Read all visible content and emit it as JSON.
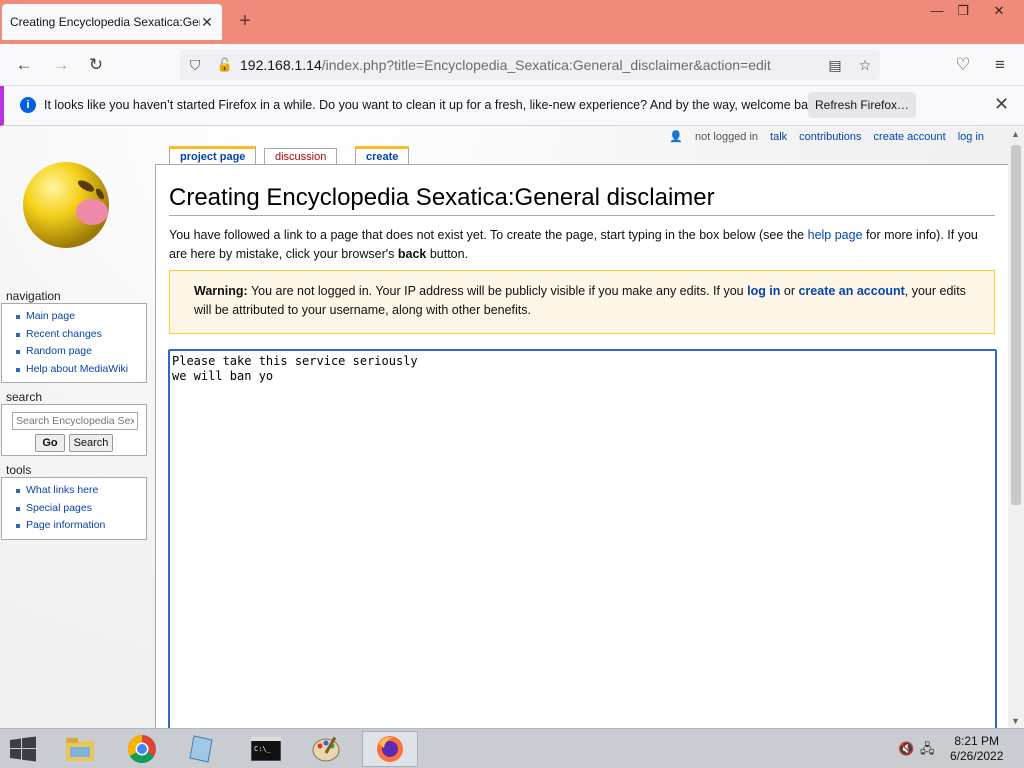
{
  "browser": {
    "tab_title": "Creating Encyclopedia Sexatica:General disclaimer",
    "url_host": "192.168.1.14",
    "url_path": "/index.php?title=Encyclopedia_Sexatica:General_disclaimer&action=edit",
    "notification": "It looks like you haven’t started Firefox in a while. Do you want to clean it up for a fresh, like-new experience? And by the way, welcome back!",
    "refresh_button": "Refresh Firefox…"
  },
  "personal_tools": [
    "not logged in",
    "talk",
    "contributions",
    "create account",
    "log in"
  ],
  "content_tabs": {
    "project_page": "project page",
    "discussion": "discussion",
    "create": "create"
  },
  "sidebar": {
    "navigation_title": "navigation",
    "navigation": [
      "Main page",
      "Recent changes",
      "Random page",
      "Help about MediaWiki"
    ],
    "search_title": "search",
    "search_placeholder": "Search Encyclopedia Sexatica",
    "go_button": "Go",
    "search_button": "Search",
    "tools_title": "tools",
    "tools": [
      "What links here",
      "Special pages",
      "Page information"
    ]
  },
  "article": {
    "heading": "Creating Encyclopedia Sexatica:General disclaimer",
    "intro_part1": "You have followed a link to a page that does not exist yet. To create the page, start typing in the box below (see the ",
    "intro_link": "help page",
    "intro_part2": " for more info). If you are here by mistake, click your browser's ",
    "intro_bold": "back",
    "intro_part3": " button.",
    "warning_label": "Warning:",
    "warning_part1": " You are not logged in. Your IP address will be publicly visible if you make any edits. If you ",
    "warning_login": "log in",
    "warning_or": " or ",
    "warning_create": "create an account",
    "warning_part2": ", your edits will be attributed to your username, along with other benefits.",
    "editbox_text": "Please take this service seriously\nwe will ban yo"
  },
  "taskbar": {
    "time": "8:21 PM",
    "date": "6/26/2022",
    "items": [
      "start-icon",
      "file-explorer-icon",
      "chrome-icon",
      "notepad-icon",
      "cmd-icon",
      "paint-icon",
      "firefox-icon"
    ]
  }
}
